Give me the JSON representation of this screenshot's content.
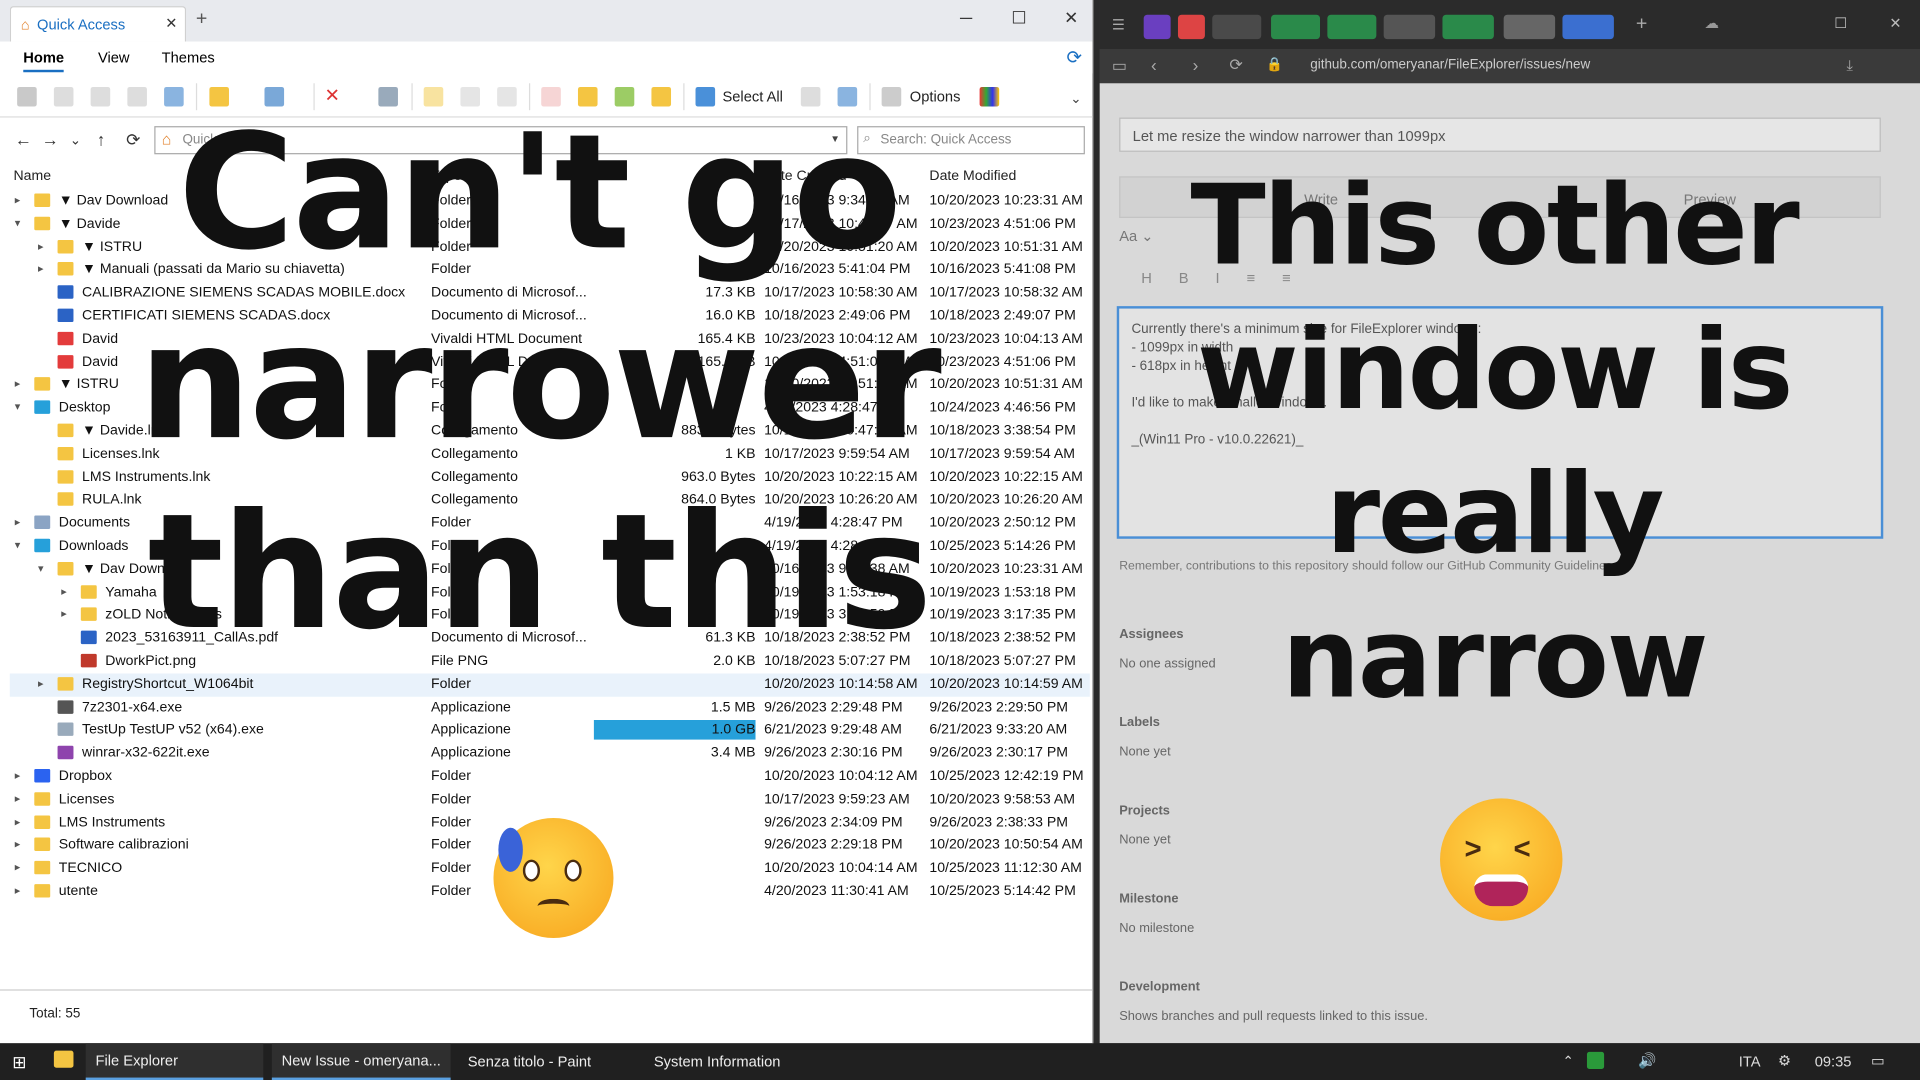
{
  "explorer": {
    "tab_title": "Quick Access",
    "ribbon_tabs": [
      "Home",
      "View",
      "Themes"
    ],
    "select_all": "Select All",
    "options": "Options",
    "address_placeholder": "Quick Access",
    "search_placeholder": "Search: Quick Access",
    "columns": [
      "Name",
      "Type",
      "Size",
      "Date Created",
      "Date Modified"
    ],
    "status": "Total: 55",
    "rows": [
      {
        "indent": 0,
        "exp": "▸",
        "name": "▼ Dav Download",
        "type": "Folder",
        "size": "",
        "created": "10/16/2023 9:34:38 AM",
        "modified": "10/20/2023 10:23:31 AM",
        "icon": "folder"
      },
      {
        "indent": 0,
        "exp": "▾",
        "name": "▼ Davide",
        "type": "Folder",
        "size": "",
        "created": "10/17/2023 10:47:37 AM",
        "modified": "10/23/2023 4:51:06 PM",
        "icon": "folder"
      },
      {
        "indent": 1,
        "exp": "▸",
        "name": "▼ ISTRU",
        "type": "Folder",
        "size": "",
        "created": "10/20/2023 10:51:20 AM",
        "modified": "10/20/2023 10:51:31 AM",
        "icon": "folder"
      },
      {
        "indent": 1,
        "exp": "▸",
        "name": "▼ Manuali (passati da Mario su chiavetta)",
        "type": "Folder",
        "size": "",
        "created": "10/16/2023 5:41:04 PM",
        "modified": "10/16/2023 5:41:08 PM",
        "icon": "folder"
      },
      {
        "indent": 1,
        "exp": "",
        "name": "CALIBRAZIONE SIEMENS SCADAS MOBILE.docx",
        "type": "Documento di Microsof...",
        "size": "17.3 KB",
        "created": "10/17/2023 10:58:30 AM",
        "modified": "10/17/2023 10:58:32 AM",
        "icon": "doc"
      },
      {
        "indent": 1,
        "exp": "",
        "name": "CERTIFICATI SIEMENS SCADAS.docx",
        "type": "Documento di Microsof...",
        "size": "16.0 KB",
        "created": "10/18/2023 2:49:06 PM",
        "modified": "10/18/2023 2:49:07 PM",
        "icon": "doc"
      },
      {
        "indent": 1,
        "exp": "",
        "name": "David",
        "type": "Vivaldi HTML Document",
        "size": "165.4 KB",
        "created": "10/23/2023 10:04:12 AM",
        "modified": "10/23/2023 10:04:13 AM",
        "icon": "vivaldi"
      },
      {
        "indent": 1,
        "exp": "",
        "name": "David",
        "type": "Vivaldi HTML Document",
        "size": "165.6 KB",
        "created": "10/23/2023 4:51:06 PM",
        "modified": "10/23/2023 4:51:06 PM",
        "icon": "vivaldi"
      },
      {
        "indent": 0,
        "exp": "▸",
        "name": "▼ ISTRU",
        "type": "Folder",
        "size": "",
        "created": "10/20/2023 10:51:20 AM",
        "modified": "10/20/2023 10:51:31 AM",
        "icon": "folder"
      },
      {
        "indent": 0,
        "exp": "▾",
        "name": "Desktop",
        "type": "Folder",
        "size": "",
        "created": "4/19/2023 4:28:47 PM",
        "modified": "10/24/2023 4:46:56 PM",
        "icon": "desktop"
      },
      {
        "indent": 1,
        "exp": "",
        "name": "▼ Davide.lnk",
        "type": "Collegamento",
        "size": "883.0 Bytes",
        "created": "10/17/2023 10:47:59 AM",
        "modified": "10/18/2023 3:38:54 PM",
        "icon": "folder"
      },
      {
        "indent": 1,
        "exp": "",
        "name": "Licenses.lnk",
        "type": "Collegamento",
        "size": "1 KB",
        "created": "10/17/2023 9:59:54 AM",
        "modified": "10/17/2023 9:59:54 AM",
        "icon": "folder"
      },
      {
        "indent": 1,
        "exp": "",
        "name": "LMS Instruments.lnk",
        "type": "Collegamento",
        "size": "963.0 Bytes",
        "created": "10/20/2023 10:22:15 AM",
        "modified": "10/20/2023 10:22:15 AM",
        "icon": "folder"
      },
      {
        "indent": 1,
        "exp": "",
        "name": "RULA.lnk",
        "type": "Collegamento",
        "size": "864.0 Bytes",
        "created": "10/20/2023 10:26:20 AM",
        "modified": "10/20/2023 10:26:20 AM",
        "icon": "folder"
      },
      {
        "indent": 0,
        "exp": "▸",
        "name": "Documents",
        "type": "Folder",
        "size": "",
        "created": "4/19/2023 4:28:47 PM",
        "modified": "10/20/2023 2:50:12 PM",
        "icon": "docs"
      },
      {
        "indent": 0,
        "exp": "▾",
        "name": "Downloads",
        "type": "Folder",
        "size": "",
        "created": "4/19/2023 4:28:47 PM",
        "modified": "10/25/2023 5:14:26 PM",
        "icon": "download"
      },
      {
        "indent": 1,
        "exp": "▾",
        "name": "▼ Dav Download",
        "type": "Folder",
        "size": "",
        "created": "10/16/2023 9:34:38 AM",
        "modified": "10/20/2023 10:23:31 AM",
        "icon": "folder"
      },
      {
        "indent": 2,
        "exp": "▸",
        "name": "Yamaha",
        "type": "Folder",
        "size": "",
        "created": "10/19/2023 1:53:18 PM",
        "modified": "10/19/2023 1:53:18 PM",
        "icon": "folder"
      },
      {
        "indent": 2,
        "exp": "▸",
        "name": "zOLD Notifications",
        "type": "Folder",
        "size": "",
        "created": "10/19/2023 3:13:59 PM",
        "modified": "10/19/2023 3:17:35 PM",
        "icon": "folder"
      },
      {
        "indent": 2,
        "exp": "",
        "name": "2023_53163911_CallAs.pdf",
        "type": "Documento di Microsof...",
        "size": "61.3 KB",
        "created": "10/18/2023 2:38:52 PM",
        "modified": "10/18/2023 2:38:52 PM",
        "icon": "doc"
      },
      {
        "indent": 2,
        "exp": "",
        "name": "DworkPict.png",
        "type": "File PNG",
        "size": "2.0 KB",
        "created": "10/18/2023 5:07:27 PM",
        "modified": "10/18/2023 5:07:27 PM",
        "icon": "png"
      },
      {
        "indent": 1,
        "exp": "▸",
        "name": "RegistryShortcut_W1064bit",
        "type": "Folder",
        "size": "",
        "created": "10/20/2023 10:14:58 AM",
        "modified": "10/20/2023 10:14:59 AM",
        "icon": "folder",
        "hl": true
      },
      {
        "indent": 1,
        "exp": "",
        "name": "7z2301-x64.exe",
        "type": "Applicazione",
        "size": "1.5 MB",
        "created": "9/26/2023 2:29:48 PM",
        "modified": "9/26/2023 2:29:50 PM",
        "icon": "exe"
      },
      {
        "indent": 1,
        "exp": "",
        "name": "TestUp TestUP v52 (x64).exe",
        "type": "Applicazione",
        "size": "1.0 GB",
        "created": "6/21/2023 9:29:48 AM",
        "modified": "6/21/2023 9:33:20 AM",
        "icon": "app",
        "bar": 1.0
      },
      {
        "indent": 1,
        "exp": "",
        "name": "winrar-x32-622it.exe",
        "type": "Applicazione",
        "size": "3.4 MB",
        "created": "9/26/2023 2:30:16 PM",
        "modified": "9/26/2023 2:30:17 PM",
        "icon": "exe2"
      },
      {
        "indent": 0,
        "exp": "▸",
        "name": "Dropbox",
        "type": "Folder",
        "size": "",
        "created": "10/20/2023 10:04:12 AM",
        "modified": "10/25/2023 12:42:19 PM",
        "icon": "dropbox"
      },
      {
        "indent": 0,
        "exp": "▸",
        "name": "Licenses",
        "type": "Folder",
        "size": "",
        "created": "10/17/2023 9:59:23 AM",
        "modified": "10/20/2023 9:58:53 AM",
        "icon": "folder"
      },
      {
        "indent": 0,
        "exp": "▸",
        "name": "LMS Instruments",
        "type": "Folder",
        "size": "",
        "created": "9/26/2023 2:34:09 PM",
        "modified": "9/26/2023 2:38:33 PM",
        "icon": "folder"
      },
      {
        "indent": 0,
        "exp": "▸",
        "name": "Software calibrazioni",
        "type": "Folder",
        "size": "",
        "created": "9/26/2023 2:29:18 PM",
        "modified": "10/20/2023 10:50:54 AM",
        "icon": "folder"
      },
      {
        "indent": 0,
        "exp": "▸",
        "name": "TECNICO",
        "type": "Folder",
        "size": "",
        "created": "10/20/2023 10:04:14 AM",
        "modified": "10/25/2023 11:12:30 AM",
        "icon": "folder"
      },
      {
        "indent": 0,
        "exp": "▸",
        "name": "utente",
        "type": "Folder",
        "size": "",
        "created": "4/20/2023 11:30:41 AM",
        "modified": "10/25/2023 5:14:42 PM",
        "icon": "folder"
      }
    ]
  },
  "browser": {
    "url": "github.com/omeryanar/FileExplorer/issues/new",
    "issue_title": "Let me resize the window narrower than 1099px",
    "tabs": [
      "Write",
      "Preview"
    ],
    "body_lines": [
      "Currently there's a minimum size for FileExplorer windows:",
      "- 1099px in width",
      "- 618px in height",
      "",
      "I'd like to make smaller windows.",
      "",
      "_(Win11 Pro - v10.0.22621)_"
    ],
    "note": "Remember, contributions to this repository should follow our GitHub Community Guidelines.",
    "sidebar": [
      [
        "Assignees",
        "No one assigned"
      ],
      [
        "Labels",
        "None yet"
      ],
      [
        "Projects",
        "None yet"
      ],
      [
        "Milestone",
        "No milestone"
      ],
      [
        "Development",
        "Shows branches and pull requests linked to this issue."
      ]
    ]
  },
  "overlay": {
    "left_text": [
      "Can't go",
      "narrower",
      "than this"
    ],
    "right_text": [
      "This other",
      "window is",
      "really",
      "narrow"
    ]
  },
  "taskbar": {
    "items": [
      "File Explorer",
      "New Issue - omeryana...",
      "Senza titolo - Paint",
      "System Information"
    ],
    "lang": "ITA",
    "time": "09:35"
  },
  "colors": {
    "accent": "#1a6fc2",
    "folder": "#f4c542",
    "bar": "#26a0da"
  }
}
